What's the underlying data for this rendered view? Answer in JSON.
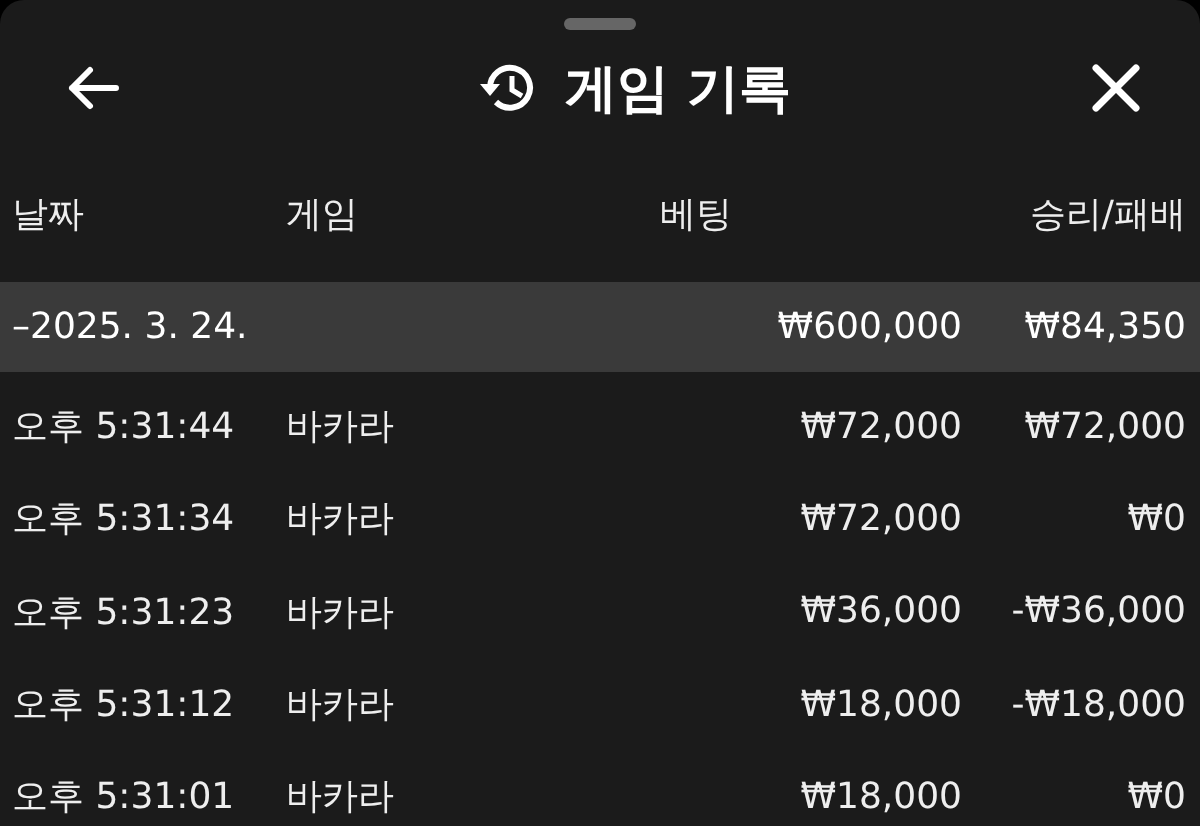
{
  "header": {
    "title": "게임 기록"
  },
  "table": {
    "columns": [
      "날짜",
      "게임",
      "베팅",
      "승리/패배"
    ],
    "groups": [
      {
        "date": "–2025. 3. 24.",
        "bet": "₩600,000",
        "result": "₩84,350",
        "rows": [
          {
            "time": "오후 5:31:44",
            "game": "바카라",
            "bet": "₩72,000",
            "result": "₩72,000"
          },
          {
            "time": "오후 5:31:34",
            "game": "바카라",
            "bet": "₩72,000",
            "result": "₩0"
          },
          {
            "time": "오후 5:31:23",
            "game": "바카라",
            "bet": "₩36,000",
            "result": "-₩36,000"
          },
          {
            "time": "오후 5:31:12",
            "game": "바카라",
            "bet": "₩18,000",
            "result": "-₩18,000"
          },
          {
            "time": "오후 5:31:01",
            "game": "바카라",
            "bet": "₩18,000",
            "result": "₩0"
          }
        ]
      }
    ]
  }
}
